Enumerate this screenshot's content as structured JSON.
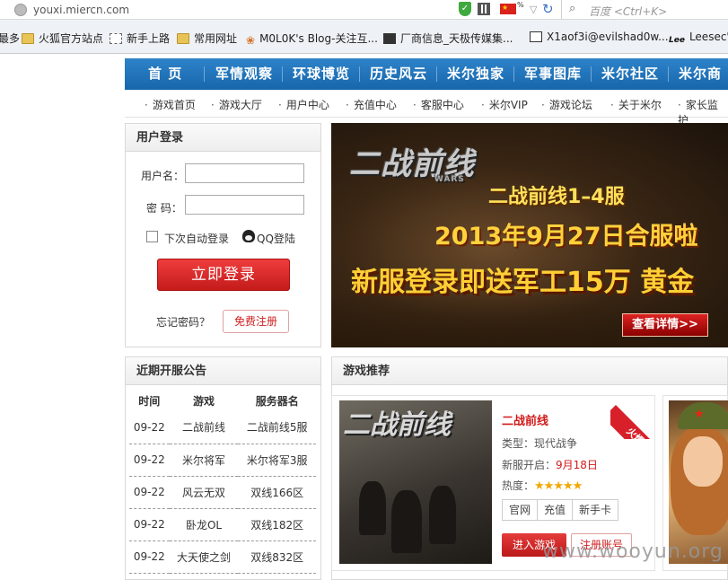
{
  "browser": {
    "url": "youxi.miercn.com",
    "zoom_indicator": "%",
    "search_placeholder": "百度 <Ctrl+K>"
  },
  "bookmarks": [
    {
      "label": "最多",
      "icon": "none"
    },
    {
      "label": "火狐官方站点",
      "icon": "folder-icon"
    },
    {
      "label": "新手上路",
      "icon": "page-icon"
    },
    {
      "label": "常用网址",
      "icon": "folder-icon"
    },
    {
      "label": "M0L0K's Blog-关注互...",
      "icon": "flower-icon"
    },
    {
      "label": "厂商信息_天极传媒集...",
      "icon": "site-icon"
    },
    {
      "label": "X1aof3i@evilshad0w...",
      "icon": "page-icon"
    },
    {
      "label": "Leesec'",
      "icon": "lee-icon"
    }
  ],
  "nav": [
    "首 页",
    "军情观察",
    "环球博览",
    "历史风云",
    "米尔独家",
    "军事图库",
    "米尔社区",
    "米尔商城"
  ],
  "subnav": [
    "游戏首页",
    "游戏大厅",
    "用户中心",
    "充值中心",
    "客服中心",
    "米尔VIP",
    "游戏论坛",
    "关于米尔",
    "家长监护"
  ],
  "login": {
    "title": "用户登录",
    "username_label": "用户名：",
    "password_label": "密  码：",
    "username_value": "",
    "password_value": "",
    "remember_label": "下次自动登录",
    "qq_login": "QQ登陆",
    "submit": "立即登录",
    "forgot": "忘记密码？",
    "register": "免费注册"
  },
  "banner": {
    "logo": "二战前线",
    "logo_sub": "WARS",
    "line1": "二战前线1–4服",
    "line2": "2013年9月27日合服啦",
    "line3": "新服登录即送军工15万 黄金",
    "detail_button": "查看详情>>"
  },
  "notice": {
    "title": "近期开服公告",
    "headers": [
      "时间",
      "游戏",
      "服务器名"
    ],
    "rows": [
      [
        "09-22",
        "二战前线",
        "二战前线5服"
      ],
      [
        "09-22",
        "米尔将军",
        "米尔将军3服"
      ],
      [
        "09-22",
        "风云无双",
        "双线166区"
      ],
      [
        "09-22",
        "卧龙OL",
        "双线182区"
      ],
      [
        "09-22",
        "大天使之剑",
        "双线832区"
      ]
    ]
  },
  "games": {
    "title": "游戏推荐",
    "card": {
      "image_logo": "二战前线",
      "name": "二战前线",
      "badge": "火爆",
      "type_label": "类型：现代战争",
      "open_label": "新服开启：",
      "open_date": "9月18日",
      "heat_label": "热度：",
      "heat_stars": 5,
      "heat_glyphs": "★★★★★",
      "links": [
        "官网",
        "充值",
        "新手卡"
      ],
      "enter": "进入游戏",
      "register": "注册账号"
    }
  },
  "watermark": "www.wooyun.org"
}
